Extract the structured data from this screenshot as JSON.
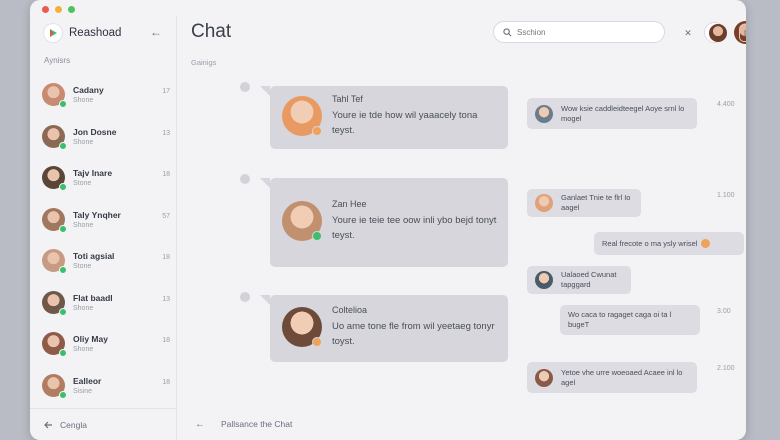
{
  "app": {
    "brand": "Reashoad",
    "title": "Chat",
    "section_label": "Aynisrs",
    "sub_label": "Gainigs"
  },
  "search": {
    "placeholder": "Sschion"
  },
  "sidebar": {
    "footer_label": "Cengla",
    "contacts": [
      {
        "name": "Cadany",
        "sub": "Shone",
        "count": "17",
        "avatar": "#c98a72"
      },
      {
        "name": "Jon Dosne",
        "sub": "Shone",
        "count": "13",
        "avatar": "#8a6a55"
      },
      {
        "name": "Tajv Inare",
        "sub": "Stone",
        "count": "18",
        "avatar": "#5a4638"
      },
      {
        "name": "Taly Ynqher",
        "sub": "Shone",
        "count": "57",
        "avatar": "#a07860"
      },
      {
        "name": "Toti agsial",
        "sub": "Stone",
        "count": "18",
        "avatar": "#c79a84"
      },
      {
        "name": "Flat baadl",
        "sub": "Shone",
        "count": "13",
        "avatar": "#6d5849"
      },
      {
        "name": "Oliy May",
        "sub": "Shone",
        "count": "18",
        "avatar": "#8e5b4a"
      },
      {
        "name": "Ealleor",
        "sub": "Sisine",
        "count": "18",
        "avatar": "#b07d63"
      }
    ]
  },
  "messages_left": [
    {
      "name": "Tahl Tef",
      "text": "Youre ie tde how wil yaaacely tona teyst.",
      "avatar": "#e89a62",
      "badge": "orange"
    },
    {
      "name": "Zan Hee",
      "text": "Youre ie teie tee oow inli ybo bejd tonyt teyst.",
      "avatar": "#c0906f",
      "badge": "green"
    },
    {
      "name": "Coltelioa",
      "text": "Uo ame tone fle from wil yeetaeg tonyr toyst.",
      "avatar": "#6e4a3a",
      "badge": "orange"
    }
  ],
  "messages_right": [
    {
      "text": "Wow ksie caddleidteegel Aoye srnl lo mogel",
      "time": "4.400",
      "avatar": "#6b7d8c"
    },
    {
      "text": "Ganlaet Tnie te flrl Io aagel",
      "time": "1.100",
      "avatar": "#e0a17a"
    },
    {
      "text": "Real frecote o ma ysly wrisel",
      "time": "",
      "avatar": ""
    },
    {
      "text": "Ualaoed Cwunat tapggard",
      "time": "",
      "avatar": "#4a5a66"
    },
    {
      "text": "Wo caca to ragaget caga oi ta l bugeT",
      "time": "3.00",
      "avatar": ""
    },
    {
      "text": "Yetoe vhe urre woeoaed Acaee inl lo agel",
      "time": "2.100",
      "avatar": "#8a5a48"
    }
  ],
  "footer": {
    "label": "Pallsance the Chat"
  },
  "colors": {
    "window": "#f3f3f6",
    "bubble": "#d6d6dc",
    "online": "#3bbf6a",
    "accent": "#f0a25a"
  }
}
